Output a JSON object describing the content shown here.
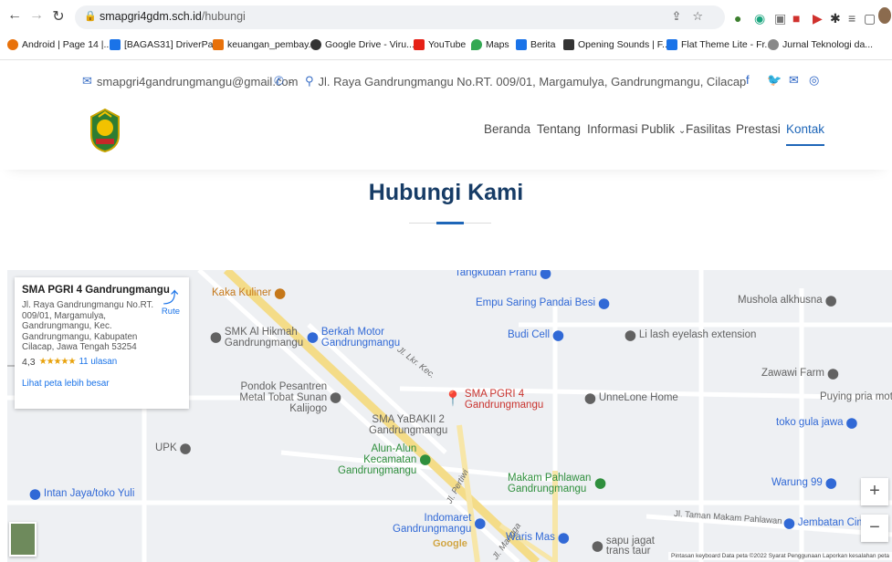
{
  "browser": {
    "url_host": "smapgri4gdm.sch.id",
    "url_path": "/hubungi",
    "bookmarks": [
      {
        "label": "Android | Page 14 |...",
        "color": "#e8710a"
      },
      {
        "label": "[BAGAS31] DriverPa...",
        "color": "#1a73e8"
      },
      {
        "label": "keuangan_pembay...",
        "color": "#e8710a"
      },
      {
        "label": "Google Drive - Viru...",
        "color": "#333333"
      },
      {
        "label": "YouTube",
        "color": "#e62117"
      },
      {
        "label": "Maps",
        "color": "#34a853"
      },
      {
        "label": "Berita",
        "color": "#1a73e8"
      },
      {
        "label": "Opening Sounds | F...",
        "color": "#333333"
      },
      {
        "label": "Flat Theme Lite - Fr...",
        "color": "#1a73e8"
      },
      {
        "label": "Jurnal Teknologi da...",
        "color": "#888888"
      }
    ]
  },
  "topbar": {
    "email": "smapgri4gandrungmangu@gmail.com",
    "phone": "-",
    "address": "Jl. Raya Gandrungmangu No.RT. 009/01, Margamulya, Gandrungmangu, Cilacap",
    "social_icons": [
      "facebook-icon",
      "twitter-icon",
      "mail-icon",
      "instagram-icon"
    ]
  },
  "nav": {
    "items": [
      "Beranda",
      "Tentang",
      "Informasi Publik",
      "Fasilitas",
      "Prestasi",
      "Kontak"
    ],
    "active": "Kontak"
  },
  "page": {
    "title": "Hubungi Kami"
  },
  "map": {
    "card": {
      "name": "SMA PGRI 4 Gandrungmangu",
      "address": "Jl. Raya Gandrungmangu No.RT. 009/01, Margamulya, Gandrungmangu, Kec. Gandrungmangu, Kabupaten Cilacap, Jawa Tengah 53254",
      "rating": "4,3",
      "stars": "★★★★★",
      "reviews": "11 ulasan",
      "bigger_map": "Lihat peta lebih besar",
      "route": "Rute"
    },
    "pois": {
      "tangkuban": "Tangkuban Prahu",
      "kaka": "Kaka Kuliner",
      "empu": "Empu Saring Pandai Besi",
      "mushola": "Mushola alkhusna",
      "smk": "SMK Al Hikmah Gandrungmangu",
      "berkah": "Berkah Motor Gandrungmangu",
      "budi": "Budi Cell",
      "lilash": "Li lash eyelash extension",
      "zawawi": "Zawawi Farm",
      "pondok": "Pondok Pesantren Metal Tobat Sunan Kalijogo",
      "smapgri": "SMA PGRI 4 Gandrungmangu",
      "unnelone": "UnneLone Home",
      "puying": "Puying pria motor",
      "yabakii": "SMA YaBAKII 2 Gandrungmangu",
      "tokogula": "toko gula jawa",
      "upk": "UPK",
      "alun": "Alun-Alun Kecamatan Gandrungmangu",
      "makam": "Makam Pahlawan Gandrungmangu",
      "warung": "Warung 99",
      "intan": "Intan Jaya/toko Yuli",
      "indomaret": "Indomaret Gandrungmangu",
      "waris": "Waris Mas",
      "sapu": "sapu jagat trans taur",
      "jembatan": "Jembatan Cimer"
    },
    "streets": {
      "lkr": "Jl. Lkr. Kec.",
      "pertiwi": "Jl. Pertiwi",
      "mangga": "Jl. Mangga",
      "taman": "Jl. Taman Makam Pahlawan"
    },
    "attribution": "Pintasan keyboard   Data peta ©2022   Syarat Penggunaan   Laporkan kesalahan peta",
    "zoom_in": "+",
    "zoom_out": "−",
    "google": "Google"
  }
}
